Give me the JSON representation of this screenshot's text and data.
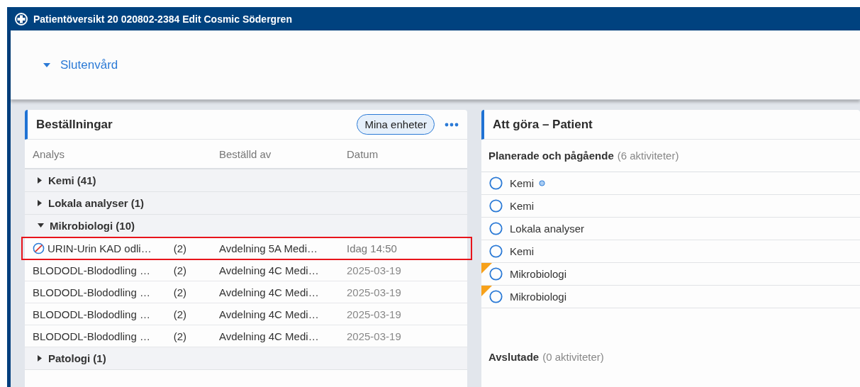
{
  "window": {
    "title": "Patientöversikt 20 020802-2384 Edit Cosmic Södergren"
  },
  "header": {
    "section_link": {
      "label": "Slutenvård",
      "expanded": true
    }
  },
  "orders_panel": {
    "title": "Beställningar",
    "filter_button": "Mina enheter",
    "columns": [
      "Analys",
      "Beställd av",
      "Datum"
    ],
    "groups": [
      {
        "label": "Kemi (41)",
        "expanded": false
      },
      {
        "label": "Lokala analyser (1)",
        "expanded": false
      },
      {
        "label": "Mikrobiologi (10)",
        "expanded": true,
        "children": [
          {
            "analysis": "URIN-Urin KAD odli…",
            "count": "(2)",
            "ordered_by": "Avdelning 5A Medi…",
            "date": "Idag 14:50",
            "cancelled": true,
            "highlighted": true
          },
          {
            "analysis": "BLODODL-Blododling …",
            "count": "(2)",
            "ordered_by": "Avdelning 4C Medi…",
            "date": "2025-03-19",
            "cancelled": false,
            "highlighted": false
          },
          {
            "analysis": "BLODODL-Blododling …",
            "count": "(2)",
            "ordered_by": "Avdelning 4C Medi…",
            "date": "2025-03-19",
            "cancelled": false,
            "highlighted": false
          },
          {
            "analysis": "BLODODL-Blododling …",
            "count": "(2)",
            "ordered_by": "Avdelning 4C Medi…",
            "date": "2025-03-19",
            "cancelled": false,
            "highlighted": false
          },
          {
            "analysis": "BLODODL-Blododling …",
            "count": "(2)",
            "ordered_by": "Avdelning 4C Medi…",
            "date": "2025-03-19",
            "cancelled": false,
            "highlighted": false
          }
        ]
      },
      {
        "label": "Patologi (1)",
        "expanded": false
      }
    ]
  },
  "todo_panel": {
    "title": "Att göra – Patient",
    "planned": {
      "heading": "Planerade och pågående",
      "count": "(6 aktiviteter)",
      "items": [
        {
          "label": "Kemi",
          "unread": true,
          "flagged": false
        },
        {
          "label": "Kemi",
          "unread": false,
          "flagged": false
        },
        {
          "label": "Lokala analyser",
          "unread": false,
          "flagged": false
        },
        {
          "label": "Kemi",
          "unread": false,
          "flagged": false
        },
        {
          "label": "Mikrobiologi",
          "unread": false,
          "flagged": true
        },
        {
          "label": "Mikrobiologi",
          "unread": false,
          "flagged": true
        }
      ]
    },
    "finished": {
      "heading": "Avslutade",
      "count": "(0 aktiviteter)"
    }
  }
}
